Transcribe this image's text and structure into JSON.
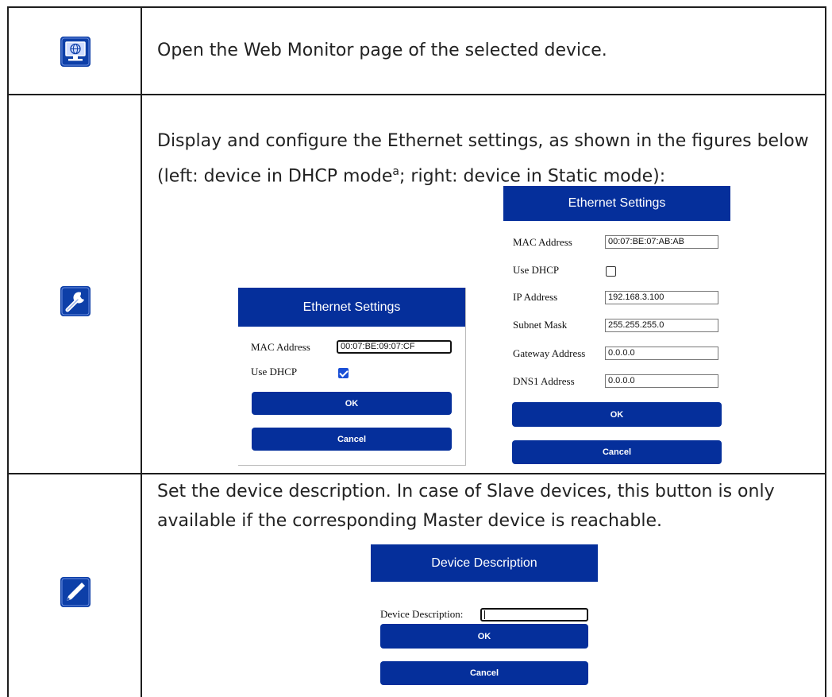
{
  "rows": [
    {
      "icon": "web-monitor-icon",
      "text": "Open the Web Monitor page of the selected device."
    },
    {
      "icon": "wrench-settings-icon",
      "text_line1": "Display and configure the Ethernet settings, as shown in the figures below",
      "text_line2_pre": "(left: device in DHCP mode",
      "text_line2_sup": "a",
      "text_line2_post": "; right: device in Static mode):"
    },
    {
      "icon": "pencil-edit-icon",
      "text_line1": "Set the device description. In case of Slave devices, this button is only",
      "text_line2": "available if the corresponding Master device is reachable."
    }
  ],
  "dhcp_dialog": {
    "title": "Ethernet Settings",
    "mac_label": "MAC Address",
    "mac_value": "00:07:BE:09:07:CF",
    "dhcp_label": "Use DHCP",
    "dhcp_checked": true,
    "ok_label": "OK",
    "cancel_label": "Cancel"
  },
  "static_dialog": {
    "title": "Ethernet Settings",
    "mac_label": "MAC Address",
    "mac_value": "00:07:BE:07:AB:AB",
    "dhcp_label": "Use DHCP",
    "dhcp_checked": false,
    "ip_label": "IP Address",
    "ip_value": "192.168.3.100",
    "subnet_label": "Subnet Mask",
    "subnet_value": "255.255.255.0",
    "gateway_label": "Gateway Address",
    "gateway_value": "0.0.0.0",
    "dns_label": "DNS1 Address",
    "dns_value": "0.0.0.0",
    "ok_label": "OK",
    "cancel_label": "Cancel"
  },
  "description_dialog": {
    "title": "Device Description",
    "desc_label": "Device Description:",
    "desc_value": "",
    "ok_label": "OK",
    "cancel_label": "Cancel"
  },
  "colors": {
    "dialog_blue": "#052f9b",
    "icon_blue": "#0d3fa8",
    "checkbox_blue": "#1a4fd6"
  }
}
